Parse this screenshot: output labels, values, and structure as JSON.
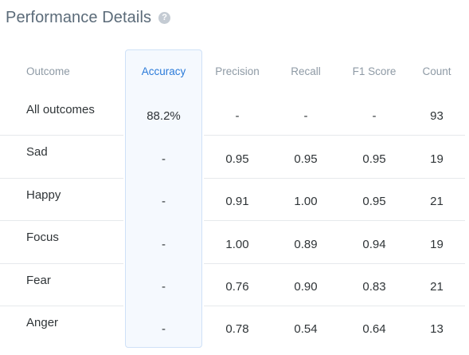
{
  "title": "Performance Details",
  "help_icon": "help-circle-icon",
  "colors": {
    "accent": "#2b7bd9",
    "highlight_bg": "#f5f9fe",
    "highlight_border": "#cfe1f7",
    "header_text": "#8e9aa5",
    "title_text": "#5b6b79"
  },
  "table": {
    "columns": [
      "Outcome",
      "Accuracy",
      "Precision",
      "Recall",
      "F1 Score",
      "Count"
    ],
    "rows": [
      {
        "outcome": "All outcomes",
        "accuracy": "88.2%",
        "precision": "-",
        "recall": "-",
        "f1": "-",
        "count": "93"
      },
      {
        "outcome": "Sad",
        "accuracy": "-",
        "precision": "0.95",
        "recall": "0.95",
        "f1": "0.95",
        "count": "19"
      },
      {
        "outcome": "Happy",
        "accuracy": "-",
        "precision": "0.91",
        "recall": "1.00",
        "f1": "0.95",
        "count": "21"
      },
      {
        "outcome": "Focus",
        "accuracy": "-",
        "precision": "1.00",
        "recall": "0.89",
        "f1": "0.94",
        "count": "19"
      },
      {
        "outcome": "Fear",
        "accuracy": "-",
        "precision": "0.76",
        "recall": "0.90",
        "f1": "0.83",
        "count": "21"
      },
      {
        "outcome": "Anger",
        "accuracy": "-",
        "precision": "0.78",
        "recall": "0.54",
        "f1": "0.64",
        "count": "13"
      }
    ]
  }
}
